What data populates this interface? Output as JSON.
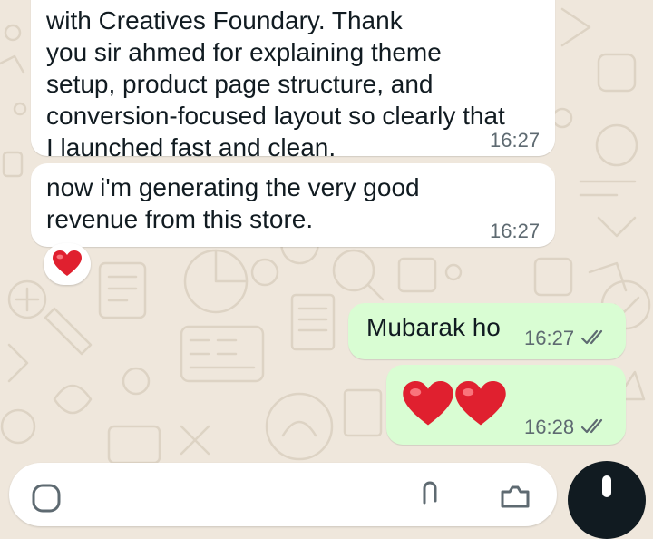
{
  "chat": {
    "messages": [
      {
        "direction": "incoming",
        "text": "with Creatives Foundary. Thank\nyou sir ahmed for explaining theme\nsetup, product page structure, and\nconversion-focused layout so clearly that\nI launched fast and clean.",
        "time": "16:27"
      },
      {
        "direction": "incoming",
        "text": "now i'm generating the very good\nrevenue from this store.",
        "time": "16:27",
        "reaction": "red-heart"
      },
      {
        "direction": "outgoing",
        "text": "Mubarak ho",
        "time": "16:27",
        "status": "read"
      },
      {
        "direction": "outgoing",
        "emoji": [
          "red-heart",
          "red-heart"
        ],
        "time": "16:28",
        "status": "read"
      }
    ]
  },
  "colors": {
    "wallpaper": "#efe7dc",
    "incoming_bubble": "#ffffff",
    "outgoing_bubble": "#d9fdd3",
    "text": "#111b21",
    "timestamp": "#5e6a71",
    "heart": "#e0202f"
  },
  "icons": {
    "reaction": "red-heart-emoji",
    "read_receipt": "double-check-icon",
    "input_emoji": "emoji-icon",
    "input_attach": "attach-icon",
    "input_camera": "camera-icon",
    "send": "mic-icon"
  }
}
